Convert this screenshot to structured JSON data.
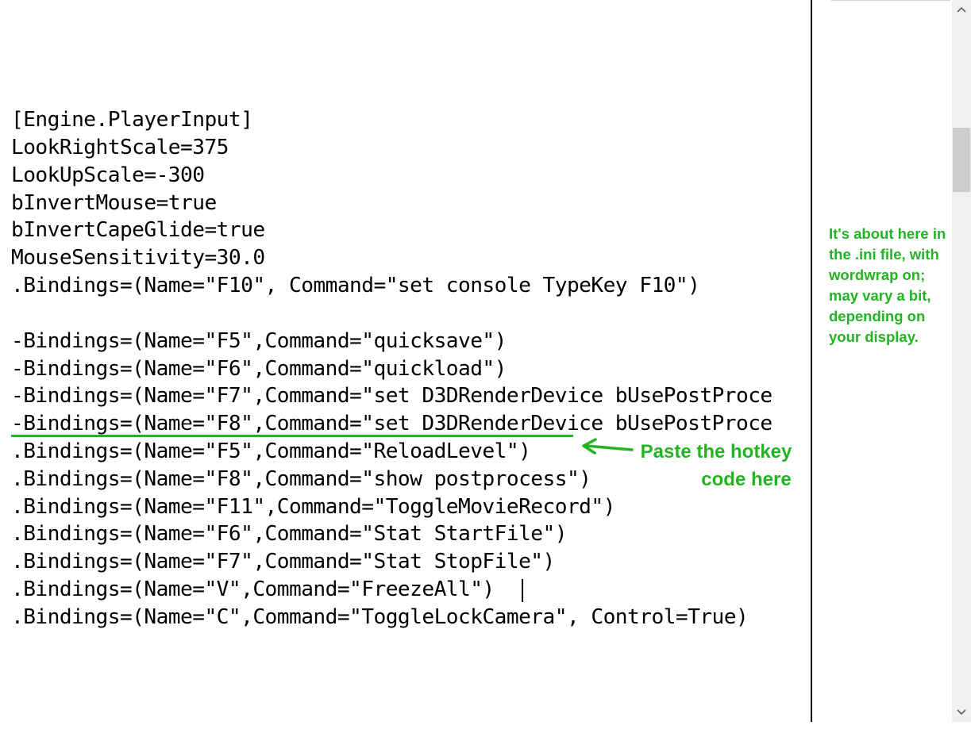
{
  "editor": {
    "lines": [
      "[Engine.PlayerInput]",
      "LookRightScale=375",
      "LookUpScale=-300",
      "bInvertMouse=true",
      "bInvertCapeGlide=true",
      "MouseSensitivity=30.0",
      ".Bindings=(Name=\"F10\", Command=\"set console TypeKey F10\")",
      "",
      "-Bindings=(Name=\"F5\",Command=\"quicksave\")",
      "-Bindings=(Name=\"F6\",Command=\"quickload\")",
      "-Bindings=(Name=\"F7\",Command=\"set D3DRenderDevice bUsePostProce",
      "-Bindings=(Name=\"F8\",Command=\"set D3DRenderDevice bUsePostProce",
      ".Bindings=(Name=\"F5\",Command=\"ReloadLevel\")",
      ".Bindings=(Name=\"F8\",Command=\"show postprocess\")",
      ".Bindings=(Name=\"F11\",Command=\"ToggleMovieRecord\")",
      ".Bindings=(Name=\"F6\",Command=\"Stat StartFile\")",
      ".Bindings=(Name=\"F7\",Command=\"Stat StopFile\")",
      ".Bindings=(Name=\"V\",Command=\"FreezeAll\")",
      ".Bindings=(Name=\"C\",Command=\"ToggleLockCamera\", Control=True)"
    ]
  },
  "side_note": "It's about here in the .ini file, with wordwrap on; may vary a bit, depending on your display.",
  "annotation": {
    "line1": "Paste the hotkey",
    "line2": "code here",
    "color": "#22b422"
  },
  "icons": {
    "scroll_up": "chevron-up-icon",
    "scroll_down": "chevron-down-icon",
    "pointer": "arrow-left-icon"
  }
}
